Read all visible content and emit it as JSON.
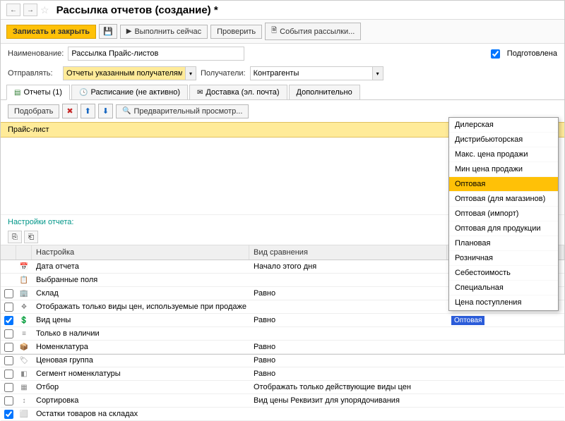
{
  "header": {
    "title": "Рассылка отчетов (создание) *"
  },
  "toolbar": {
    "save_close": "Записать и закрыть",
    "save_icon": "💾",
    "run_now": "Выполнить сейчас",
    "check": "Проверить",
    "events": "События рассылки..."
  },
  "field": {
    "name_lbl": "Наименование:",
    "name_val": "Рассылка Прайс-листов",
    "send_lbl": "Отправлять:",
    "send_val": "Отчеты указанным получателям",
    "recip_lbl": "Получатели:",
    "recip_val": "Контрагенты",
    "prepared_lbl": "Подготовлена"
  },
  "tabs": {
    "t1": "Отчеты (1)",
    "t2": "Расписание (не активно)",
    "t3": "Доставка (эл. почта)",
    "t4": "Дополнительно"
  },
  "toolbar2": {
    "pick": "Подобрать",
    "preview": "Предварительный просмотр..."
  },
  "band": {
    "title": "Прайс-лист"
  },
  "settings": {
    "lbl": "Настройки отчета:"
  },
  "gridhdr": {
    "c2": "Настройка",
    "c3": "Вид сравнения"
  },
  "rows": [
    {
      "chk": null,
      "ico": "📅",
      "label": "Дата отчета",
      "cmp": "Начало этого дня",
      "val": ""
    },
    {
      "chk": null,
      "ico": "📋",
      "label": "Выбранные поля",
      "cmp": "",
      "val": ""
    },
    {
      "chk": false,
      "ico": "🏢",
      "label": "Склад",
      "cmp": "Равно",
      "val": ""
    },
    {
      "chk": false,
      "ico": "❖",
      "label": "Отображать только виды цен, используемые при продаже",
      "cmp": "",
      "val": ""
    },
    {
      "chk": true,
      "ico": "💲",
      "label": "Вид цены",
      "cmp": "Равно",
      "val": "Оптовая"
    },
    {
      "chk": false,
      "ico": "≡",
      "label": "Только в наличии",
      "cmp": "",
      "val": ""
    },
    {
      "chk": false,
      "ico": "📦",
      "label": "Номенклатура",
      "cmp": "Равно",
      "val": ""
    },
    {
      "chk": false,
      "ico": "🏷",
      "label": "Ценовая группа",
      "cmp": "Равно",
      "val": ""
    },
    {
      "chk": false,
      "ico": "◧",
      "label": "Сегмент номенклатуры",
      "cmp": "Равно",
      "val": ""
    },
    {
      "chk": false,
      "ico": "▦",
      "label": "Отбор",
      "cmp": "Отображать только действующие виды цен",
      "val": ""
    },
    {
      "chk": false,
      "ico": "↕",
      "label": "Сортировка",
      "cmp": "Вид цены Реквизит для упорядочивания",
      "val": ""
    },
    {
      "chk": true,
      "ico": "⬜",
      "label": "Остатки товаров на складах",
      "cmp": "",
      "val": ""
    }
  ],
  "dropdown": {
    "items": [
      "Дилерская",
      "Дистрибьюторская",
      "Макс. цена продажи",
      "Мин цена продажи",
      "Оптовая",
      "Оптовая (для магазинов)",
      "Оптовая (импорт)",
      "Оптовая для продукции",
      "Плановая",
      "Розничная",
      "Себестоимость",
      "Специальная",
      "Цена поступления"
    ],
    "selected": 4
  }
}
